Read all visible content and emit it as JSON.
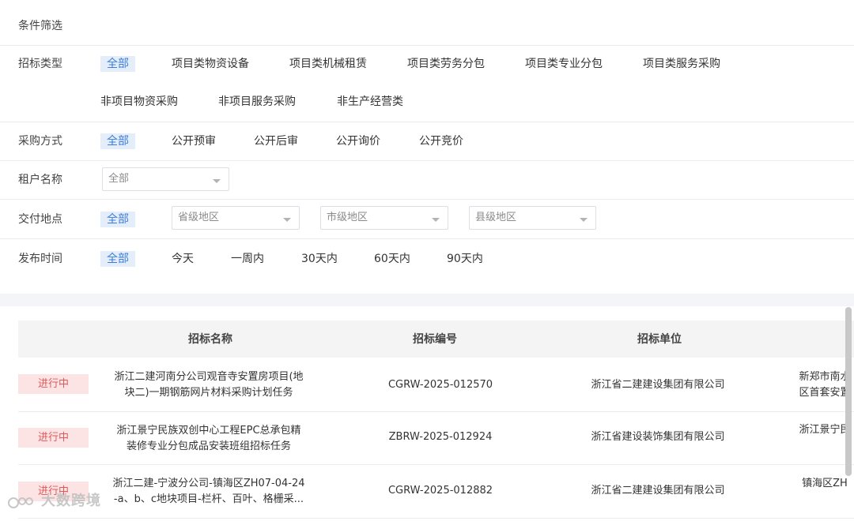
{
  "filter": {
    "title": "条件筛选",
    "bid_type": {
      "label": "招标类型",
      "options": [
        "全部",
        "项目类物资设备",
        "项目类机械租赁",
        "项目类劳务分包",
        "项目类专业分包",
        "项目类服务采购",
        "非项目物资采购",
        "非项目服务采购",
        "非生产经营类"
      ]
    },
    "purchase_method": {
      "label": "采购方式",
      "options": [
        "全部",
        "公开预审",
        "公开后审",
        "公开询价",
        "公开竞价"
      ]
    },
    "tenant": {
      "label": "租户名称",
      "value": "全部"
    },
    "delivery": {
      "label": "交付地点",
      "all": "全部",
      "province_placeholder": "省级地区",
      "city_placeholder": "市级地区",
      "county_placeholder": "县级地区"
    },
    "publish_time": {
      "label": "发布时间",
      "options": [
        "全部",
        "今天",
        "一周内",
        "30天内",
        "60天内",
        "90天内"
      ]
    },
    "active_color": "#3d7dd8"
  },
  "table": {
    "headers": [
      "招标名称",
      "招标编号",
      "招标单位"
    ],
    "rows": [
      {
        "status": "进行中",
        "name_line1": "浙江二建河南分公司观音寺安置房项目(地",
        "name_line2": "块二)一期钢筋网片材料采购计划任务",
        "code": "CGRW-2025-012570",
        "unit": "浙江省二建建设集团有限公司",
        "extra_line1": "新郑市南水",
        "extra_line2": "区首套安置"
      },
      {
        "status": "进行中",
        "name_line1": "浙江景宁民族双创中心工程EPC总承包精",
        "name_line2": "装修专业分包成品安装班组招标任务",
        "code": "ZBRW-2025-012924",
        "unit": "浙江省建设装饰集团有限公司",
        "extra_line1": "浙江景宁民",
        "extra_line2": ""
      },
      {
        "status": "进行中",
        "name_line1": "浙江二建-宁波分公司-镇海区ZH07-04-24",
        "name_line2": "-a、b、c地块项目-栏杆、百叶、格栅采...",
        "code": "CGRW-2025-012882",
        "unit": "浙江省二建建设集团有限公司",
        "extra_line1": "镇海区ZH",
        "extra_line2": ""
      }
    ],
    "status_color": "#e0585a"
  },
  "watermark": "大数跨境"
}
